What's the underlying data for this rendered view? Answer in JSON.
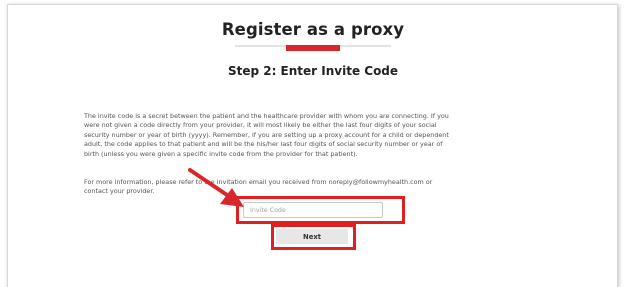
{
  "page": {
    "title": "Register as a proxy",
    "accent_color": "#d8262a",
    "highlight_color": "#e02020"
  },
  "step": {
    "title": "Step 2: Enter Invite Code"
  },
  "instructions": {
    "line_1": "The invite code is a secret between the patient and the healthcare provider with whom you are connecting.  If you",
    "line_2": "were not given a code directly from your provider, it will most likely be either the last four digits of your social",
    "line_3": "security number or year of birth (yyyy).  Remember, if you are setting up a proxy account for a child or dependent",
    "line_4": "adult, the code applies to that patient and will be the his/her last four digits of social security number or year of",
    "line_5": "birth (unless you were given a specific invite code from the provider for that patient).",
    "more_info_1": "For more information, please refer to the invitation email you received from noreply@followmyhealth.com or",
    "more_info_2": "contact your provider."
  },
  "form": {
    "invite_code_placeholder": "Invite Code",
    "invite_code_value": "",
    "next_label": "Next"
  },
  "annotations": {
    "arrow_icon": "red-arrow-icon"
  }
}
